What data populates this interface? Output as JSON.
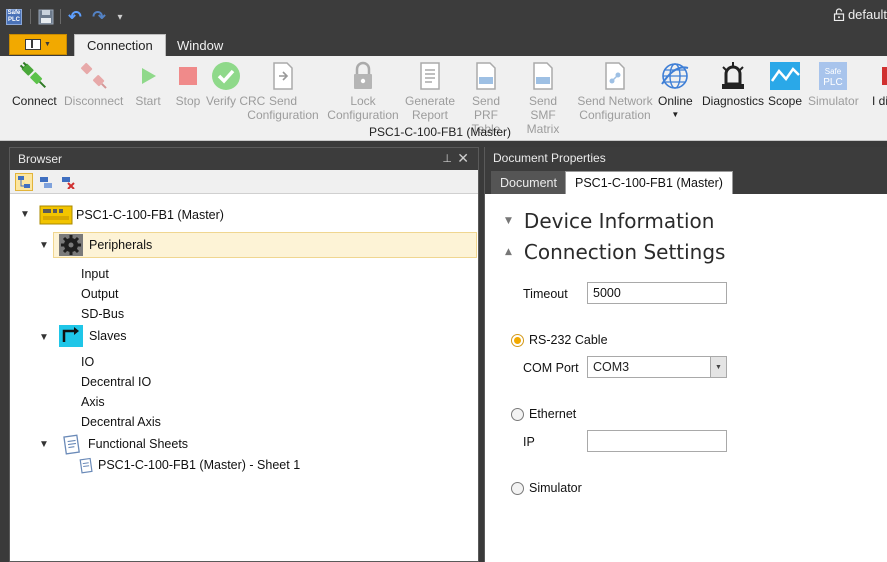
{
  "titlebar": {
    "logo_text": "Safe PLC",
    "profile_label": "default"
  },
  "tabs": {
    "connection": "Connection",
    "window": "Window"
  },
  "ribbon": {
    "buttons": [
      {
        "id": "connect",
        "label": "Connect",
        "enabled": true,
        "icon": "plug-connect-icon"
      },
      {
        "id": "disconnect",
        "label": "Disconnect",
        "enabled": false,
        "icon": "plug-disconnect-icon"
      },
      {
        "id": "start",
        "label": "Start",
        "enabled": false,
        "icon": "play-icon"
      },
      {
        "id": "stop",
        "label": "Stop",
        "enabled": false,
        "icon": "stop-icon"
      },
      {
        "id": "verify",
        "label": "Verify CRC",
        "enabled": false,
        "icon": "check-circle-icon"
      },
      {
        "id": "send-config",
        "label": "Send Configuration",
        "enabled": false,
        "icon": "send-document-icon"
      },
      {
        "id": "lock",
        "label": "Lock Configuration",
        "enabled": false,
        "icon": "lock-icon"
      },
      {
        "id": "report",
        "label": "Generate Report",
        "enabled": false,
        "icon": "report-icon"
      },
      {
        "id": "prf",
        "label": "Send PRF Table",
        "enabled": false,
        "icon": "prf-document-icon"
      },
      {
        "id": "smf",
        "label": "Send SMF Matrix",
        "enabled": false,
        "icon": "smf-document-icon"
      },
      {
        "id": "network",
        "label": "Send Network Configuration",
        "enabled": false,
        "icon": "network-document-icon"
      },
      {
        "id": "online",
        "label": "Online",
        "enabled": true,
        "icon": "globe-icon"
      },
      {
        "id": "diagnostics",
        "label": "Diagnostics",
        "enabled": true,
        "icon": "alarm-light-icon"
      },
      {
        "id": "scope",
        "label": "Scope",
        "enabled": true,
        "icon": "waveform-icon"
      },
      {
        "id": "simulator",
        "label": "Simulator",
        "enabled": false,
        "icon": "safeplc-logo-icon"
      }
    ],
    "group_label": "PSC1-C-100-FB1 (Master)",
    "partial_right": "I dia"
  },
  "browser": {
    "title": "Browser",
    "tree": {
      "root": "PSC1-C-100-FB1 (Master)",
      "peripherals": "Peripherals",
      "peripheral_items": [
        "Input",
        "Output",
        "SD-Bus"
      ],
      "slaves": "Slaves",
      "slave_items": [
        "IO",
        "Decentral IO",
        "Axis",
        "Decentral Axis"
      ],
      "functional_sheets": "Functional Sheets",
      "sheet_items": [
        "PSC1-C-100-FB1 (Master) - Sheet 1"
      ]
    }
  },
  "docprops": {
    "title": "Document Properties",
    "tab_document": "Document",
    "tab_device": "PSC1-C-100-FB1 (Master)",
    "section_device": "Device Information",
    "section_connection": "Connection Settings",
    "timeout_label": "Timeout",
    "timeout_value": "5000",
    "rs232_label": "RS-232 Cable",
    "rs232_selected": true,
    "comport_label": "COM Port",
    "comport_value": "COM3",
    "ethernet_label": "Ethernet",
    "ip_label": "IP",
    "ip_value": "",
    "simulator_label": "Simulator"
  }
}
